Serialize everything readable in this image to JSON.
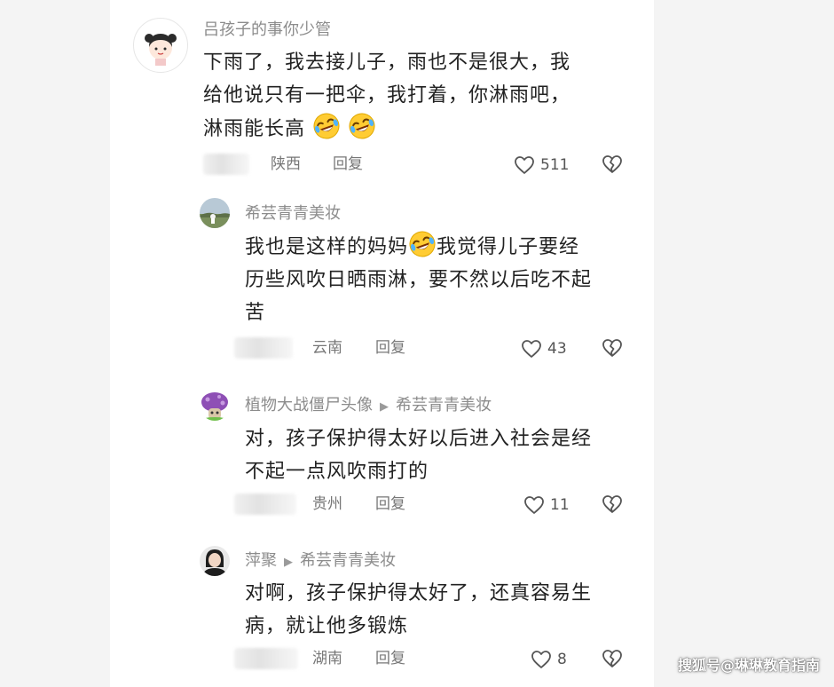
{
  "comments": [
    {
      "author": "吕孩子的事你少管",
      "text_lines": [
        "下雨了，我去接儿子，雨也不是很大，我",
        "给他说只有一把伞，我打着，你淋雨吧，",
        "淋雨能长高"
      ],
      "location": "陕西",
      "reply_label": "回复",
      "likes": "511"
    },
    {
      "author": "希芸青青美妆",
      "text_lines": [
        "我也是这样的妈妈",
        "我觉得儿子要经",
        "历些风吹日晒雨淋，要不然以后吃不起",
        "苦"
      ],
      "location": "云南",
      "reply_label": "回复",
      "likes": "43"
    },
    {
      "author": "植物大战僵尸头像",
      "reply_to": "希芸青青美妆",
      "text_lines": [
        "对，孩子保护得太好以后进入社会是经",
        "不起一点风吹雨打的"
      ],
      "location": "贵州",
      "reply_label": "回复",
      "likes": "11"
    },
    {
      "author": "萍聚",
      "reply_to": "希芸青青美妆",
      "text_lines": [
        "对啊，孩子保护得太好了，还真容易生",
        "病，就让他多锻炼"
      ],
      "location": "湖南",
      "reply_label": "回复",
      "likes": "8"
    }
  ],
  "icons": {
    "like": "heart-outline-icon",
    "dislike": "broken-heart-icon",
    "emoji": "rofl-emoji-icon",
    "reply_arrow": "triangle-right-icon"
  },
  "colors": {
    "author": "#8c8c8c",
    "text": "#222222",
    "meta": "#777777",
    "emoji_face": "#ffcc33"
  },
  "watermark": {
    "text": "搜狐号@琳琳教育指南"
  }
}
